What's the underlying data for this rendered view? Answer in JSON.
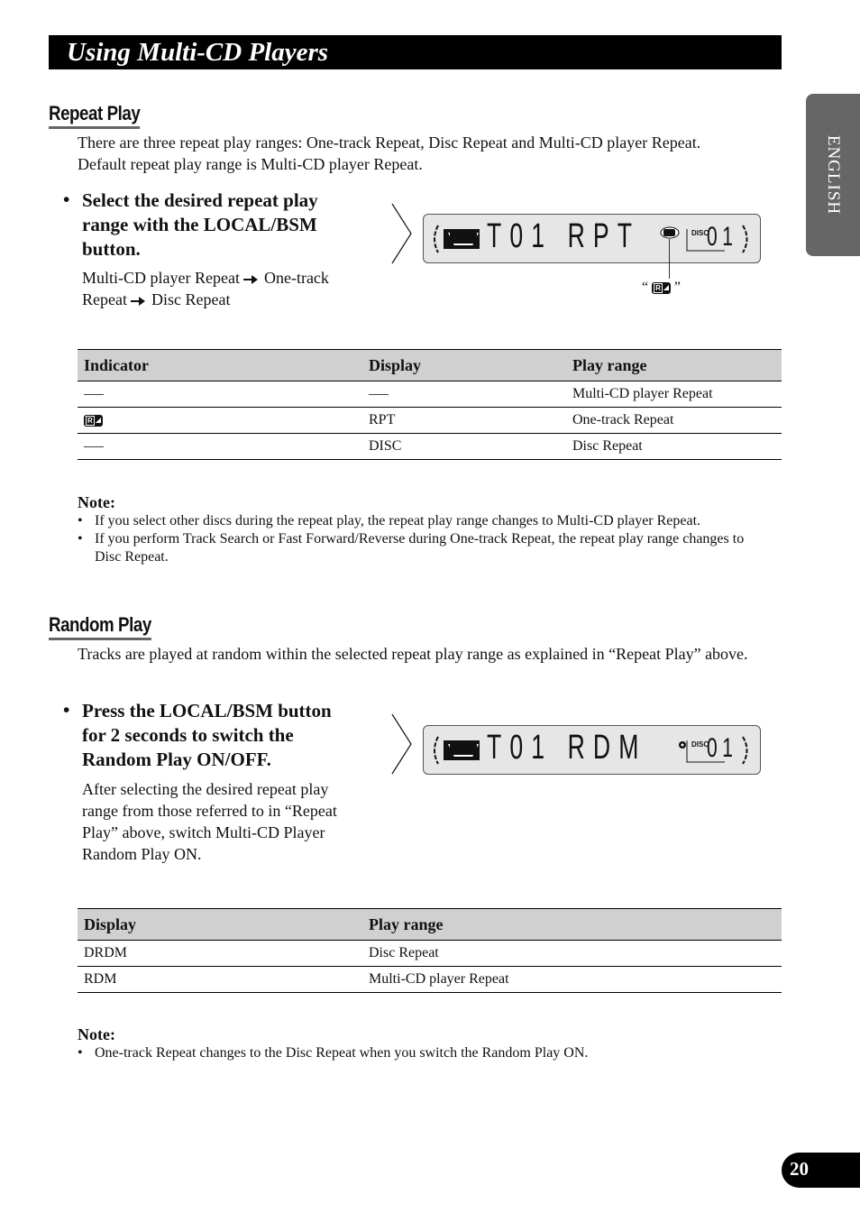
{
  "page": {
    "title": "Using Multi-CD Players",
    "language_tab": "ENGLISH",
    "page_number": "20"
  },
  "repeat_play": {
    "heading": "Repeat Play",
    "intro": "There are three repeat play ranges: One-track Repeat, Disc Repeat and Multi-CD player Repeat. Default repeat play range is Multi-CD player Repeat.",
    "step": {
      "bullet": "•",
      "instruction": "Select the desired repeat play range with the LOCAL/BSM button.",
      "sequence": [
        "Multi-CD player Repeat",
        "One-track Repeat",
        "Disc Repeat"
      ]
    },
    "display": {
      "main": "T01 RPT",
      "disc_label": "DISC",
      "disc_number": "01",
      "callout_open": "“",
      "callout_close": "”",
      "callout_icon": "repeat-indicator-icon"
    },
    "table": {
      "headers": [
        "Indicator",
        "Display",
        "Play range"
      ],
      "rows": [
        {
          "indicator": "—",
          "display": "—",
          "range": "Multi-CD player Repeat"
        },
        {
          "indicator": "repeat-indicator-icon",
          "display": "RPT",
          "range": "One-track Repeat"
        },
        {
          "indicator": "—",
          "display": "DISC",
          "range": "Disc Repeat"
        }
      ]
    },
    "note": {
      "heading": "Note:",
      "items": [
        "If you select other discs during the repeat play, the repeat play range changes to Multi-CD player Repeat.",
        "If you perform Track Search or Fast Forward/Reverse during One-track Repeat, the repeat play range changes to Disc Repeat."
      ]
    }
  },
  "random_play": {
    "heading": "Random Play",
    "intro": "Tracks are played at random within the selected repeat play range as explained in “Repeat Play” above.",
    "step": {
      "bullet": "•",
      "instruction": "Press the LOCAL/BSM button for 2 seconds to switch the Random Play ON/OFF.",
      "description": "After selecting the desired repeat play range from those referred to in “Repeat Play” above, switch Multi-CD Player Random Play ON."
    },
    "display": {
      "main": "T01 RDM",
      "disc_label": "DISC",
      "disc_number": "01"
    },
    "table": {
      "headers": [
        "Display",
        "Play range"
      ],
      "rows": [
        {
          "display": "DRDM",
          "range": "Disc Repeat"
        },
        {
          "display": "RDM",
          "range": "Multi-CD player Repeat"
        }
      ]
    },
    "note": {
      "heading": "Note:",
      "items": [
        "One-track Repeat changes to the Disc Repeat when you switch the Random Play ON."
      ]
    }
  }
}
